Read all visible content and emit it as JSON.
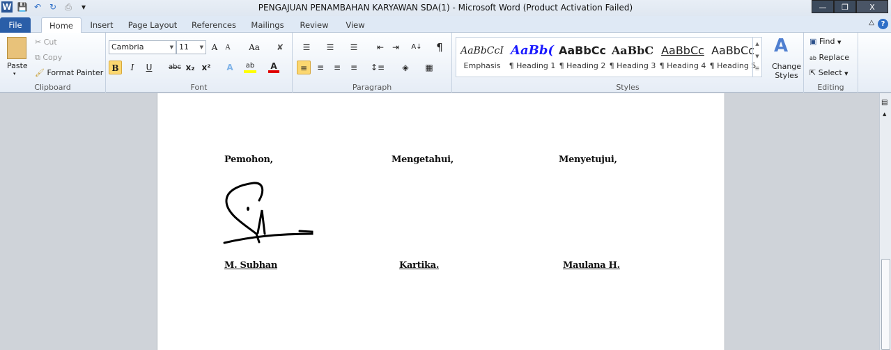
{
  "window": {
    "title": "PENGAJUAN PENAMBAHAN KARYAWAN SDA(1)  -  Microsoft Word (Product Activation Failed)",
    "minimize": "—",
    "restore": "❐",
    "close": "X"
  },
  "quick_access": {
    "icons": [
      "word-logo",
      "save-icon",
      "undo-icon",
      "redo-icon",
      "print-icon",
      "customize-icon"
    ],
    "logo": "W"
  },
  "tabs": [
    {
      "label": "File"
    },
    {
      "label": "Home",
      "active": true
    },
    {
      "label": "Insert"
    },
    {
      "label": "Page Layout"
    },
    {
      "label": "References"
    },
    {
      "label": "Mailings"
    },
    {
      "label": "Review"
    },
    {
      "label": "View"
    }
  ],
  "clipboard": {
    "paste": "Paste",
    "cut": "Cut",
    "copy": "Copy",
    "format_painter": "Format Painter",
    "label": "Clipboard"
  },
  "font": {
    "name": "Cambria",
    "size": "11",
    "grow": "A",
    "shrink": "A",
    "case": "Aa",
    "bold": "B",
    "italic": "I",
    "underline": "U",
    "strike": "abc",
    "sub": "x₂",
    "sup": "x²",
    "label": "Font",
    "highlight_color": "#ffff00",
    "font_color": "#e00000"
  },
  "paragraph": {
    "label": "Paragraph",
    "pilcrow": "¶"
  },
  "styles": {
    "label": "Styles",
    "items": [
      {
        "preview": "AaBbCcI",
        "name": "Emphasis"
      },
      {
        "preview": "AaBb(",
        "name": "¶ Heading 1"
      },
      {
        "preview": "AaBbCc",
        "name": "¶ Heading 2"
      },
      {
        "preview": "AaBbC",
        "name": "¶ Heading 3"
      },
      {
        "preview": "AaBbCc",
        "name": "¶ Heading 4"
      },
      {
        "preview": "AaBbCc",
        "name": "¶ Heading 5"
      }
    ],
    "change_styles": "Change Styles"
  },
  "editing": {
    "label": "Editing",
    "find": "Find",
    "replace": "Replace",
    "select": "Select"
  },
  "document": {
    "roles": [
      "Pemohon,",
      "Mengetahui,",
      "Menyetujui,"
    ],
    "names": [
      "M. Subhan",
      "Kartika.",
      "Maulana H."
    ]
  }
}
